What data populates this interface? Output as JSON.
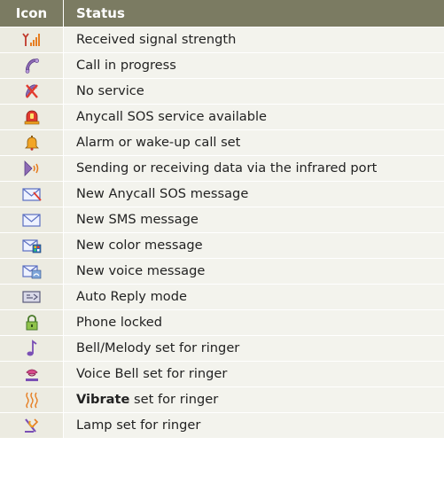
{
  "table": {
    "header": {
      "icon": "Icon",
      "status": "Status"
    },
    "rows": [
      {
        "icon": "signal-strength-icon",
        "status": "Received signal strength"
      },
      {
        "icon": "call-in-progress-icon",
        "status": "Call in progress"
      },
      {
        "icon": "no-service-icon",
        "status": "No service"
      },
      {
        "icon": "sos-service-icon",
        "status": "Anycall SOS service available"
      },
      {
        "icon": "alarm-bell-icon",
        "status": "Alarm or wake-up call set"
      },
      {
        "icon": "infrared-icon",
        "status": "Sending or receiving data via the infrared port"
      },
      {
        "icon": "sos-message-icon",
        "status": "New Anycall SOS message"
      },
      {
        "icon": "sms-envelope-icon",
        "status": "New SMS message"
      },
      {
        "icon": "color-message-icon",
        "status": "New color message"
      },
      {
        "icon": "voice-message-icon",
        "status": "New voice message"
      },
      {
        "icon": "auto-reply-icon",
        "status": "Auto Reply mode"
      },
      {
        "icon": "padlock-icon",
        "status": "Phone locked"
      },
      {
        "icon": "music-note-icon",
        "status": "Bell/Melody set for ringer"
      },
      {
        "icon": "voice-bell-icon",
        "status": "Voice Bell set for ringer"
      },
      {
        "icon": "vibrate-icon",
        "status_bold": "Vibrate",
        "status": " set for ringer"
      },
      {
        "icon": "lamp-icon",
        "status": "Lamp set for ringer"
      }
    ]
  },
  "colors": {
    "header_bg": "#7b7b62",
    "icon_col_bg": "#ecebe1",
    "status_col_bg": "#f3f3ed"
  }
}
